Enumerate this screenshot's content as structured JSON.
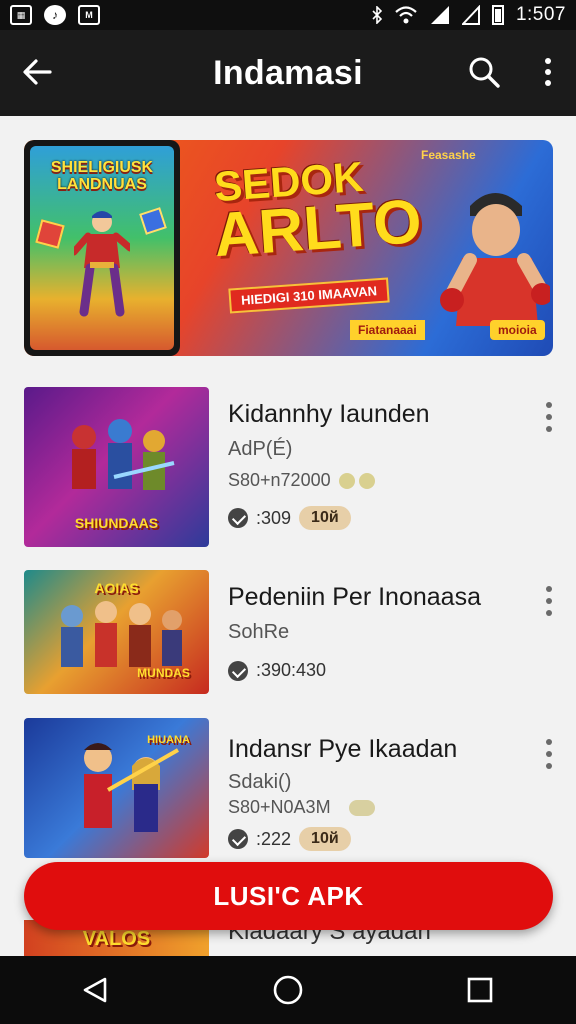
{
  "status_bar": {
    "time": "1:507",
    "notification_icons": [
      "gallery-icon",
      "music-icon",
      "mail-icon"
    ]
  },
  "app_bar": {
    "title": "Indamasi"
  },
  "banner": {
    "headline_line1": "SEDOK",
    "headline_line2": "ARLTO",
    "ribbon": "HIEDIGI 310 IMAAVAN",
    "tag_top": "Feasashe",
    "tag_bottom_left": "Fiatanaaai",
    "tag_bottom_right": "moioia",
    "tablet_title": "SHIELIGIUSK LANDNUAS",
    "colors": {
      "accent": "#f16a12",
      "text": "#ffdc1c"
    }
  },
  "items": [
    {
      "title": "Kidannhy Iaunden",
      "subtitle": "AdP(É)",
      "size": "S80+n72000",
      "rating": ":309",
      "badge": "10й",
      "thumb_label": "SHIUNDAAS"
    },
    {
      "title": "Pedeniin Per Inonaasa",
      "subtitle": "SohRe",
      "rating": ":390:430",
      "thumb_label_top": "AOIAS",
      "thumb_label": "MUNDAS"
    },
    {
      "title": "Indansr Pye Ikaadan",
      "subtitle": "Sdaki()",
      "size": "S80+N0A3M",
      "rating": ":222",
      "badge": "10й",
      "thumb_label": "HIUANA"
    }
  ],
  "partial_item": {
    "title": "Kiadaary S  ayadan",
    "thumb_label": "VALOS"
  },
  "fab": {
    "label": "LUSI'C APK",
    "color": "#e00d0d"
  }
}
